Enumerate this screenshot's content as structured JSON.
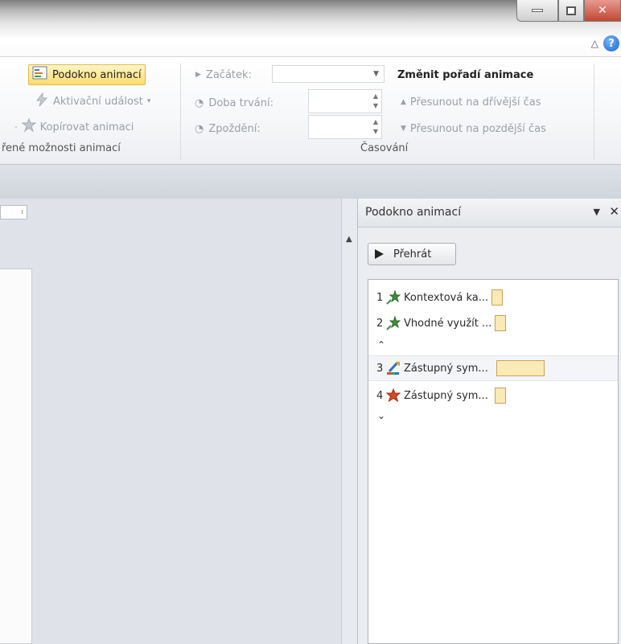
{
  "ribbon": {
    "pane_button": "Podokno animací",
    "trigger_button": "Aktivační událost",
    "copy_button": "Kopírovat animaci",
    "advanced_group": "řené možnosti animací",
    "start_label": "Začátek:",
    "duration_label": "Doba trvání:",
    "delay_label": "Zpoždění:",
    "timing_group": "Časování",
    "reorder_title": "Změnit pořadí animace",
    "move_earlier": "Přesunout na dřívější čas",
    "move_later": "Přesunout na pozdější čas"
  },
  "pane": {
    "title": "Podokno animací",
    "play_button": "Přehrát",
    "items": [
      {
        "num": "1",
        "label": "Kontextová ka...",
        "icon": "green-star-entrance-icon"
      },
      {
        "num": "2",
        "label": "Vhodné využít ...",
        "icon": "green-star-entrance-icon"
      },
      {
        "num": "3",
        "label": "Zástupný sym...",
        "icon": "motion-path-icon"
      },
      {
        "num": "4",
        "label": "Zástupný sym...",
        "icon": "red-star-emphasis-icon"
      }
    ]
  },
  "colors": {
    "active_button": "#ffdc6e",
    "timing_bar": "#fbe9b6",
    "ribbon_bg": "#f6f7f9"
  }
}
